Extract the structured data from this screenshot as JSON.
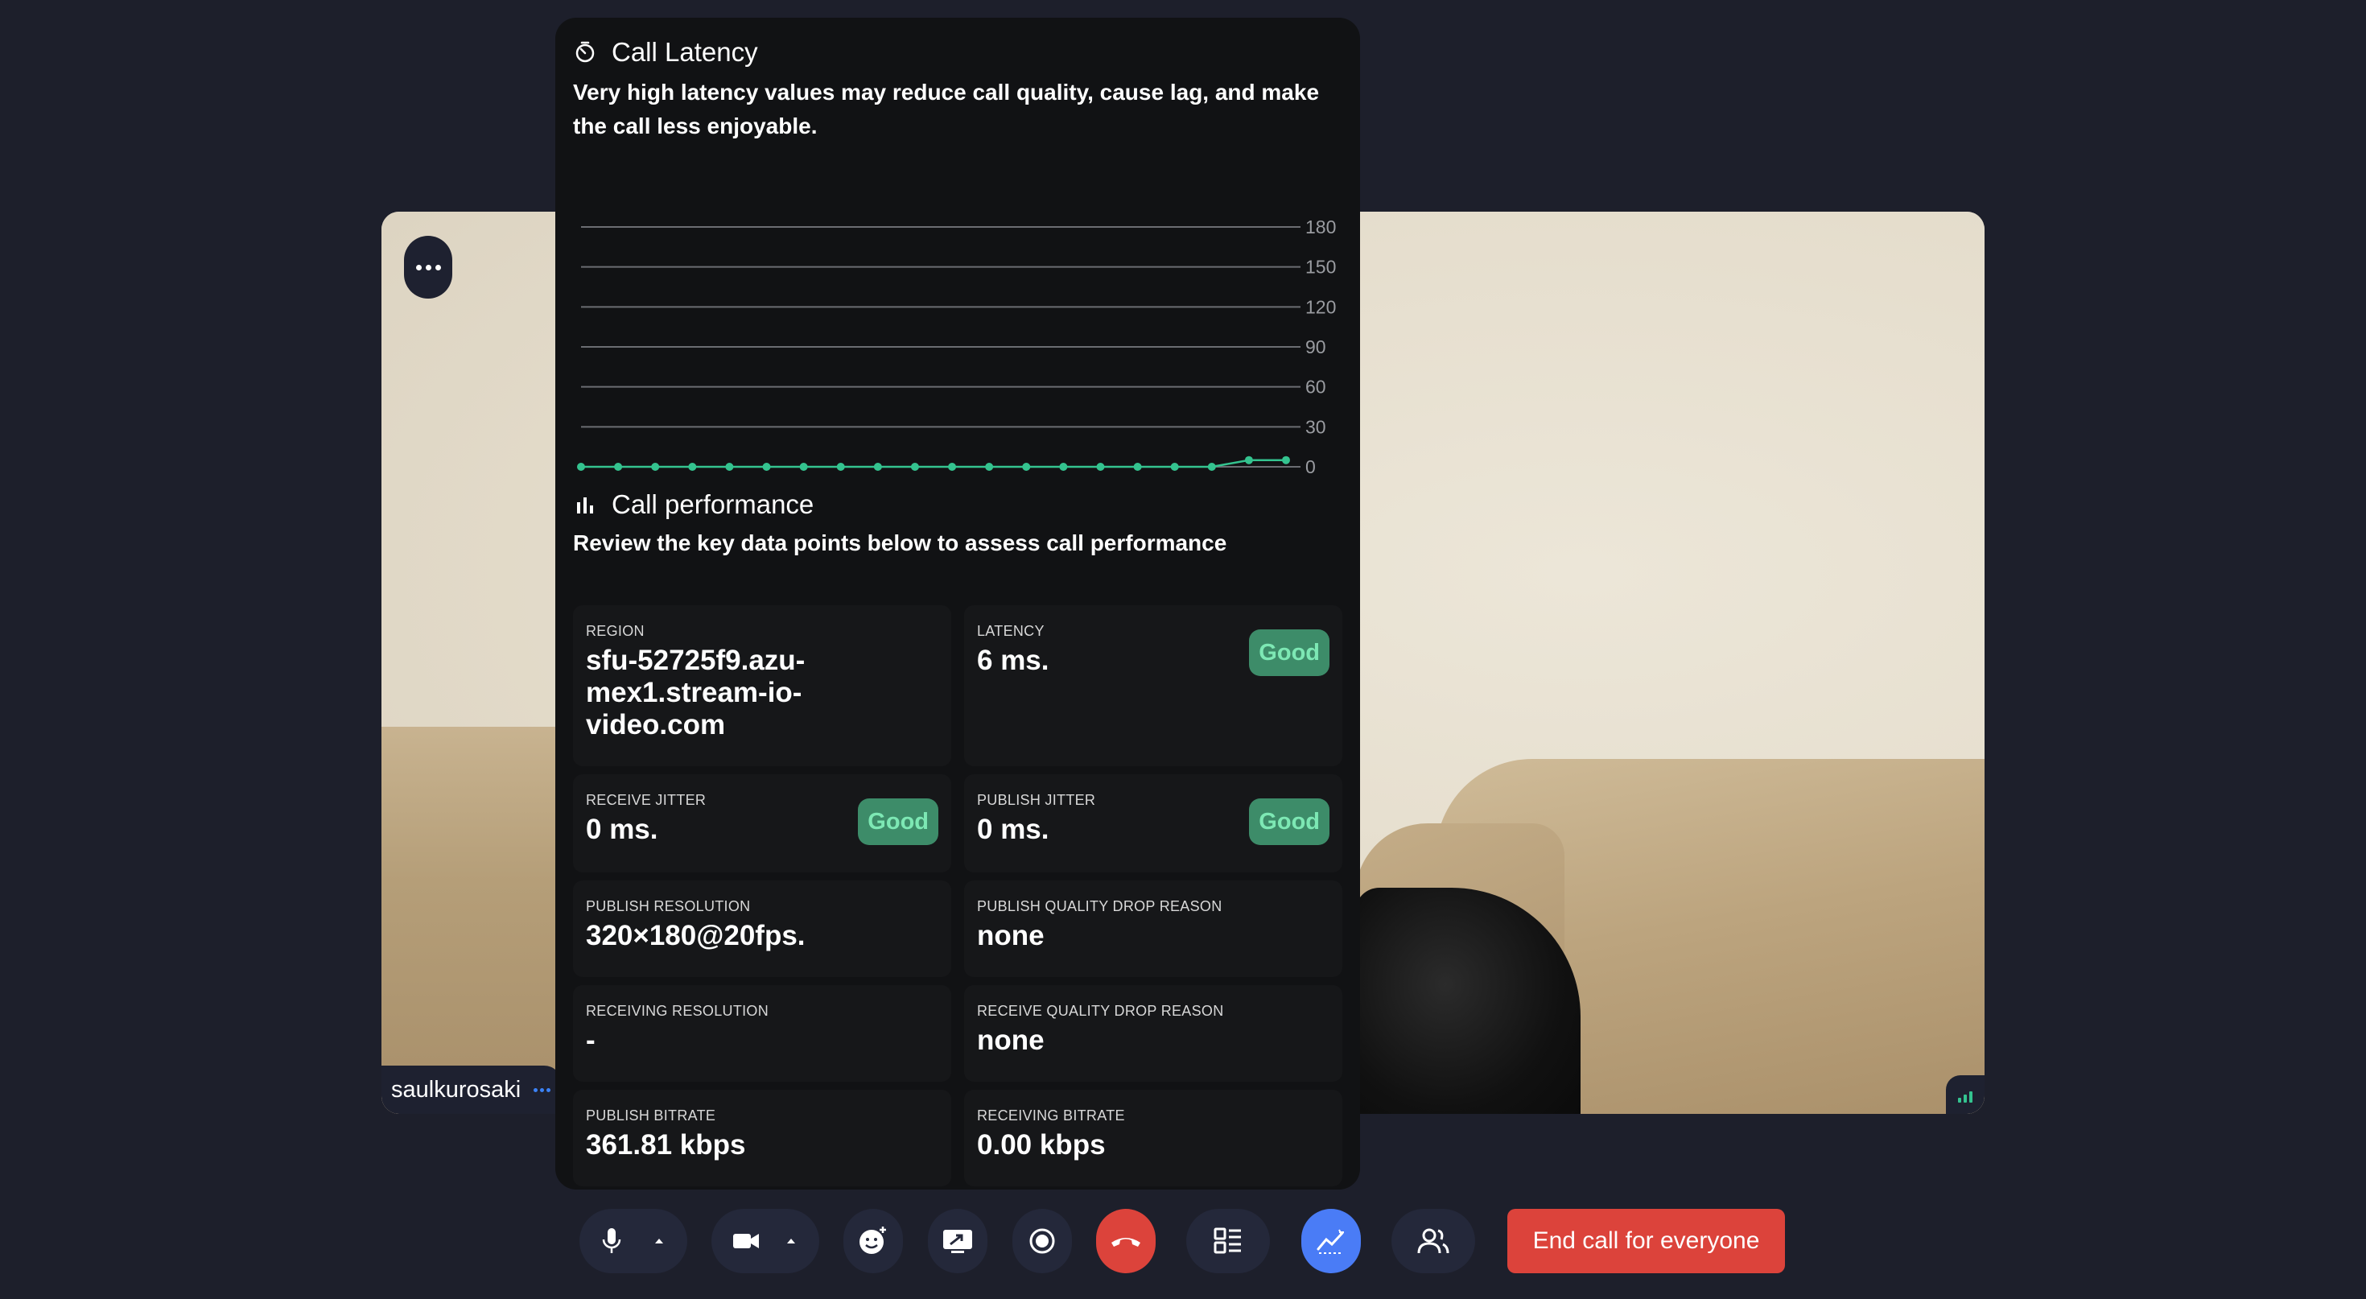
{
  "participant": {
    "name": "saulkurosaki"
  },
  "latency_section": {
    "title": "Call Latency",
    "description": "Very high latency values may reduce call quality, cause lag, and make the call less enjoyable."
  },
  "chart_data": {
    "type": "line",
    "title": "",
    "xlabel": "",
    "ylabel": "",
    "ylim": [
      0,
      180
    ],
    "yticks": [
      0,
      30,
      60,
      90,
      120,
      150,
      180
    ],
    "y_axis_side": "right",
    "grid": true,
    "series": [
      {
        "values": [
          0,
          0,
          0,
          0,
          0,
          0,
          0,
          0,
          0,
          0,
          0,
          0,
          0,
          0,
          0,
          0,
          0,
          0,
          5,
          5
        ],
        "color": "#34c38f"
      }
    ]
  },
  "performance_section": {
    "title": "Call performance",
    "description": "Review the key data points below to assess call performance"
  },
  "stats": [
    {
      "label": "REGION",
      "value": "sfu-52725f9.azu-mex1.stream-io-video.com",
      "badge": ""
    },
    {
      "label": "LATENCY",
      "value": "6 ms.",
      "badge": "Good"
    },
    {
      "label": "RECEIVE JITTER",
      "value": "0 ms.",
      "badge": "Good"
    },
    {
      "label": "PUBLISH JITTER",
      "value": "0 ms.",
      "badge": "Good"
    },
    {
      "label": "PUBLISH RESOLUTION",
      "value": "320×180@20fps.",
      "badge": ""
    },
    {
      "label": "PUBLISH QUALITY DROP REASON",
      "value": "none",
      "badge": ""
    },
    {
      "label": "RECEIVING RESOLUTION",
      "value": "-",
      "badge": ""
    },
    {
      "label": "RECEIVE QUALITY DROP REASON",
      "value": "none",
      "badge": ""
    },
    {
      "label": "PUBLISH BITRATE",
      "value": "361.81 kbps",
      "badge": ""
    },
    {
      "label": "RECEIVING BITRATE",
      "value": "0.00 kbps",
      "badge": ""
    }
  ],
  "controls": {
    "end_call_label": "End call for everyone",
    "icons": [
      "microphone-icon",
      "camera-icon",
      "reaction-icon",
      "screen-share-icon",
      "record-icon",
      "hang-up-icon",
      "layout-icon",
      "stats-icon",
      "participants-icon"
    ]
  },
  "colors": {
    "background": "#1d1f2b",
    "panel": "#111214",
    "accent_blue": "#4a7cf6",
    "good_green": "#3d8c69",
    "danger_red": "#dc433b"
  }
}
